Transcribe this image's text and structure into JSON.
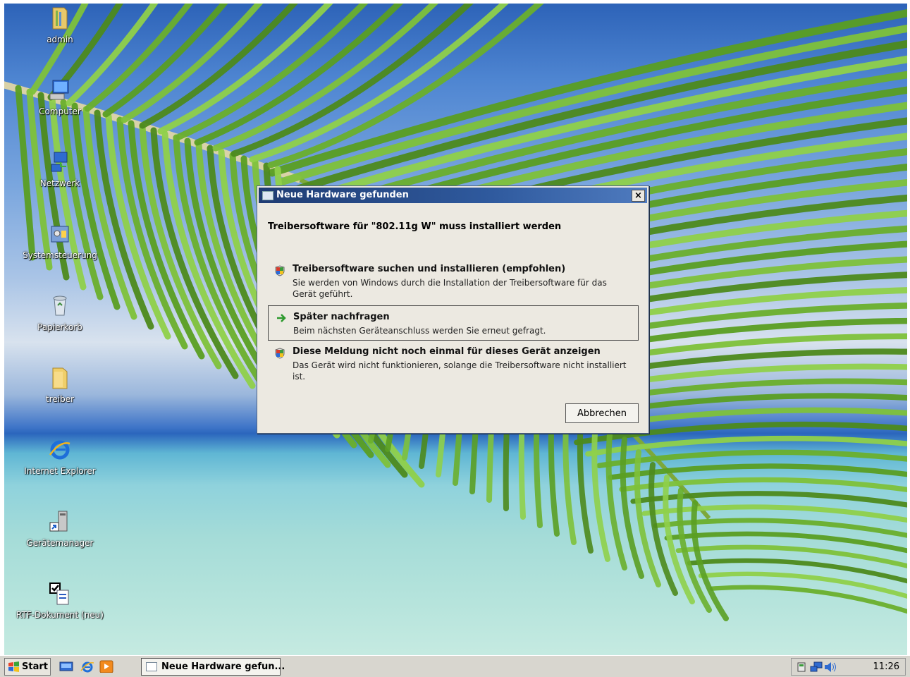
{
  "desktop": {
    "icons": [
      {
        "label": "admin",
        "icon": "user-folder-icon"
      },
      {
        "label": "Computer",
        "icon": "computer-icon"
      },
      {
        "label": "Netzwerk",
        "icon": "network-icon"
      },
      {
        "label": "Systemsteuerung",
        "icon": "control-panel-icon"
      },
      {
        "label": "Papierkorb",
        "icon": "recycle-bin-icon"
      },
      {
        "label": "treiber",
        "icon": "folder-icon"
      },
      {
        "label": "Internet Explorer",
        "icon": "internet-explorer-icon"
      },
      {
        "label": "Gerätemanager",
        "icon": "device-manager-shortcut-icon"
      },
      {
        "label": "RTF-Dokument (neu)",
        "icon": "rtf-document-icon"
      }
    ]
  },
  "dialog": {
    "title": "Neue Hardware gefunden",
    "close_label": "×",
    "heading": "Treibersoftware für \"802.11g W\" muss installiert werden",
    "options": [
      {
        "title": "Treibersoftware suchen und installieren (empfohlen)",
        "description": "Sie werden von Windows durch die Installation der Treibersoftware für das Gerät geführt.",
        "icon": "shield-icon"
      },
      {
        "title": "Später nachfragen",
        "description": "Beim nächsten Geräteanschluss werden Sie erneut gefragt.",
        "icon": "green-arrow-icon"
      },
      {
        "title": "Diese Meldung nicht noch einmal für dieses Gerät anzeigen",
        "description": "Das Gerät wird nicht funktionieren, solange die Treibersoftware nicht installiert ist.",
        "icon": "shield-icon"
      }
    ],
    "cancel_label": "Abbrechen"
  },
  "taskbar": {
    "start_label": "Start",
    "quick_launch": [
      "show-desktop-icon",
      "internet-explorer-icon",
      "media-player-icon"
    ],
    "task_item_label": "Neue Hardware gefun...",
    "tray_icons": [
      "safely-remove-hardware-icon",
      "network-icon",
      "volume-icon"
    ],
    "clock": "11:26"
  },
  "colors": {
    "titlebar": "#1f3c73",
    "dialog_bg": "#ece9e1",
    "taskbar_bg": "#d8d6cf"
  }
}
